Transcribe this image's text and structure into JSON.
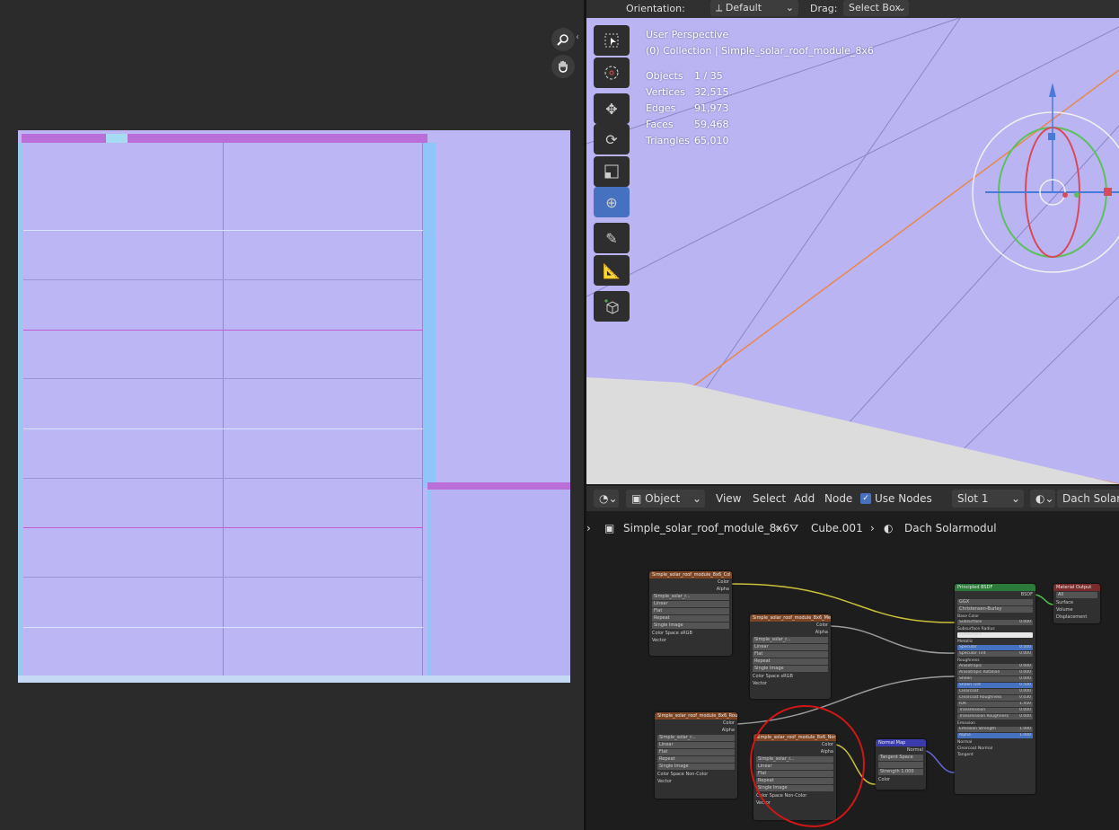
{
  "viewport_header": {
    "orientation_label": "Orientation:",
    "orientation_value": "Default",
    "drag_label": "Drag:",
    "drag_value": "Select Box"
  },
  "viewport_info": {
    "perspective": "User Perspective",
    "collection": "(0) Collection | Simple_solar_roof_module_8x6",
    "stats": [
      {
        "label": "Objects",
        "value": "1 / 35"
      },
      {
        "label": "Vertices",
        "value": "32,515"
      },
      {
        "label": "Edges",
        "value": "91,973"
      },
      {
        "label": "Faces",
        "value": "59,468"
      },
      {
        "label": "Triangles",
        "value": "65,010"
      }
    ]
  },
  "tools": [
    "select-box-icon",
    "cursor-icon",
    "move-icon",
    "rotate-icon",
    "scale-icon",
    "transform-icon",
    "annotate-icon",
    "measure-icon",
    "add-cube-icon"
  ],
  "node_header": {
    "mode": "Object",
    "menus": [
      "View",
      "Select",
      "Add",
      "Node"
    ],
    "use_nodes_label": "Use Nodes",
    "use_nodes_checked": true,
    "slot": "Slot 1",
    "material": "Dach Solarm"
  },
  "breadcrumb": {
    "object": "Simple_solar_roof_module_8x6",
    "mesh": "Cube.001",
    "material": "Dach Solarmodul"
  },
  "nodes": {
    "tex1": {
      "title": "Simple_solar_roof_module_8x6_Col",
      "color_space": "sRGB"
    },
    "tex2": {
      "title": "Simple_solar_roof_module_8x6_Met",
      "color_space": "sRGB"
    },
    "tex3": {
      "title": "Simple_solar_roof_module_8x6_Rou",
      "color_space": "Non-Color"
    },
    "tex4": {
      "title": "Simple_solar_roof_module_8x6_Nor",
      "color_space": "Non-Color"
    },
    "tex_common": {
      "color_out": "Color",
      "alpha_out": "Alpha",
      "image": "Simple_solar_r...",
      "interp": "Linear",
      "proj": "Flat",
      "ext": "Repeat",
      "src": "Single Image",
      "cs_label": "Color Space",
      "vector": "Vector"
    },
    "normal_map": {
      "title": "Normal Map",
      "out": "Normal",
      "space": "Tangent Space",
      "strength_label": "Strength",
      "strength": "1.000",
      "color_in": "Color"
    },
    "bsdf": {
      "title": "Principled BSDF",
      "out": "BSDF",
      "dist": "GGX",
      "sss": "Christensen-Burley",
      "rows": [
        {
          "l": "Base Color",
          "v": ""
        },
        {
          "l": "Subsurface",
          "v": "0.000"
        },
        {
          "l": "Subsurface Radius",
          "v": ""
        },
        {
          "l": "Subsurface ...",
          "v": ""
        },
        {
          "l": "Metallic",
          "v": ""
        },
        {
          "l": "Specular",
          "v": "0.500"
        },
        {
          "l": "Specular Tint",
          "v": "0.000"
        },
        {
          "l": "Roughness",
          "v": ""
        },
        {
          "l": "Anisotropic",
          "v": "0.000"
        },
        {
          "l": "Anisotropic Rotation",
          "v": "0.000"
        },
        {
          "l": "Sheen",
          "v": "0.000"
        },
        {
          "l": "Sheen Tint",
          "v": "0.500"
        },
        {
          "l": "Clearcoat",
          "v": "0.000"
        },
        {
          "l": "Clearcoat Roughness",
          "v": "0.030"
        },
        {
          "l": "IOR",
          "v": "1.450"
        },
        {
          "l": "Transmission",
          "v": "0.000"
        },
        {
          "l": "Transmission Roughness",
          "v": "0.000"
        },
        {
          "l": "Emission",
          "v": ""
        },
        {
          "l": "Emission Strength",
          "v": "1.000"
        },
        {
          "l": "Alpha",
          "v": "1.000"
        },
        {
          "l": "Normal",
          "v": ""
        },
        {
          "l": "Clearcoat Normal",
          "v": ""
        },
        {
          "l": "Tangent",
          "v": ""
        }
      ]
    },
    "output": {
      "title": "Material Output",
      "target": "All",
      "surface": "Surface",
      "volume": "Volume",
      "displacement": "Displacement"
    }
  }
}
